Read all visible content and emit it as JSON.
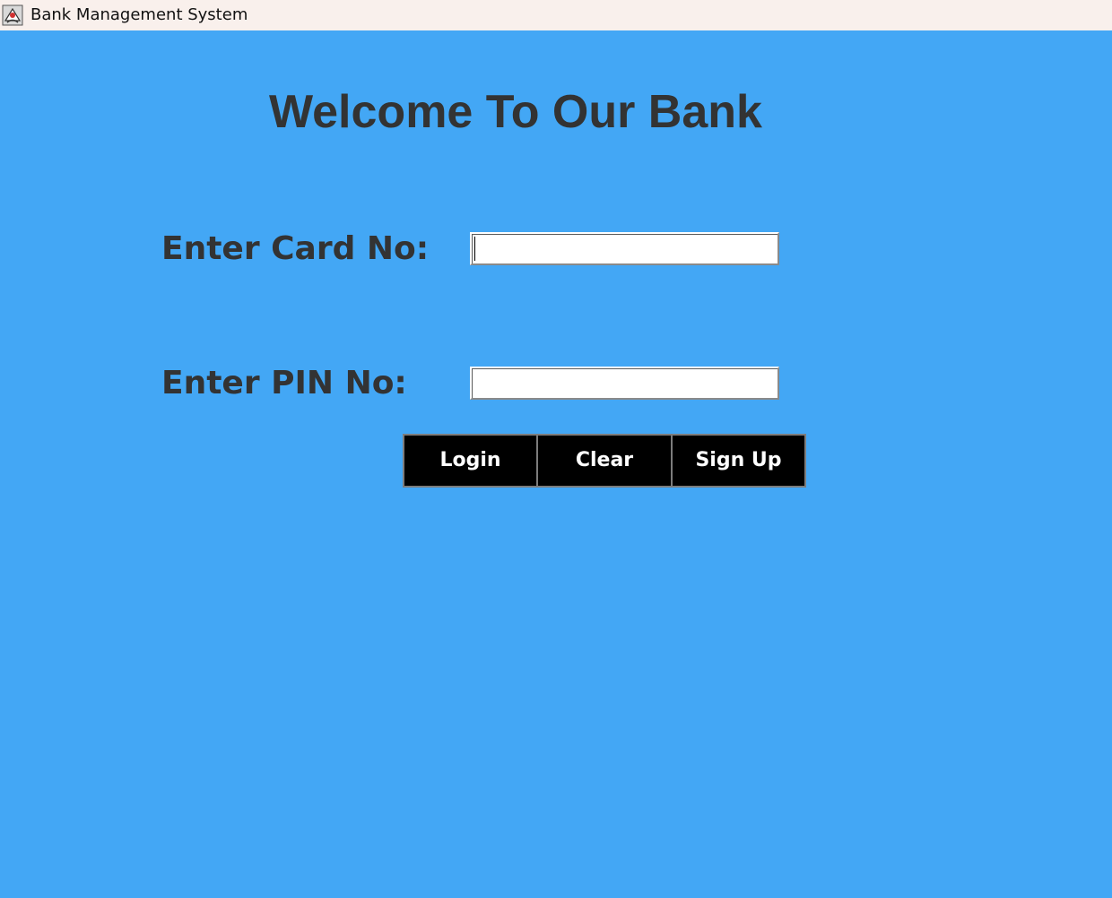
{
  "window": {
    "title": "Bank Management System",
    "icon": "java-app-icon"
  },
  "main": {
    "heading": "Welcome To Our Bank",
    "card_label": "Enter Card No:",
    "card_value": "",
    "pin_label": "Enter PIN No:",
    "pin_value": ""
  },
  "buttons": {
    "login": "Login",
    "clear": "Clear",
    "signup": "Sign Up"
  },
  "colors": {
    "background": "#43a7f5",
    "titlebar": "#f9f0ec",
    "text": "#333333",
    "button_bg": "#000000",
    "button_text": "#ffffff"
  }
}
